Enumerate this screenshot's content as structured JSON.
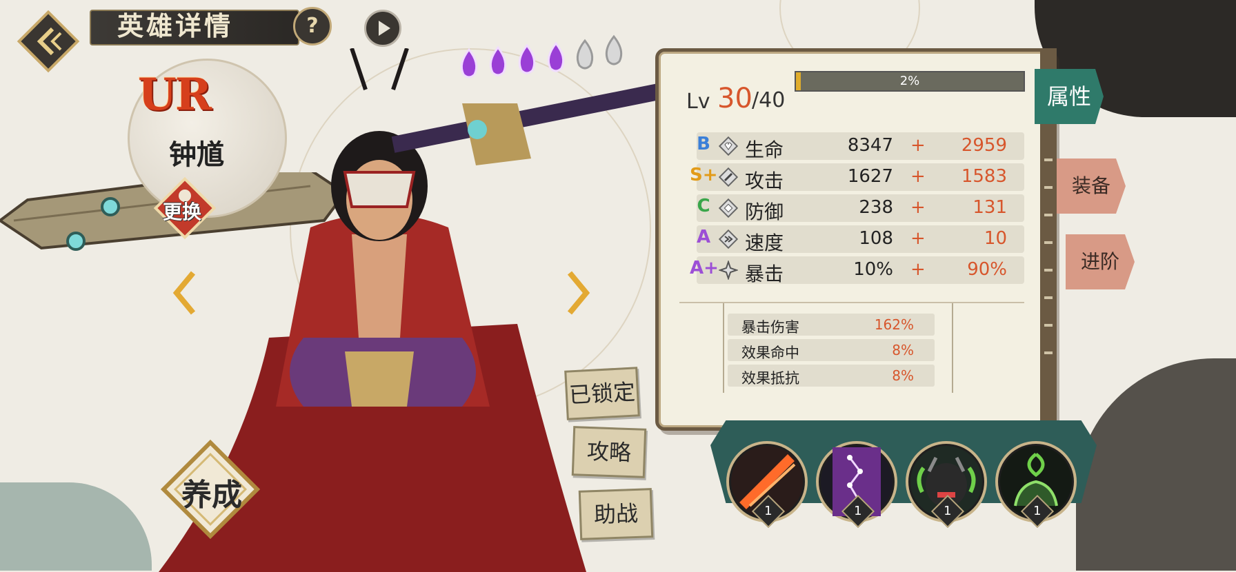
{
  "header": {
    "title": "英雄详情",
    "help_label": "?"
  },
  "hero": {
    "rarity": "UR",
    "name": "钟馗",
    "swap_label": "更换",
    "stars_filled": 4,
    "stars_total": 6
  },
  "side_buttons": {
    "locked": "已锁定",
    "guide": "攻略",
    "support": "助战",
    "cultivate": "养成"
  },
  "level": {
    "label": "Lv",
    "current": "30",
    "max": "/40",
    "exp_text": "2%",
    "exp_fraction": 0.02
  },
  "stats": [
    {
      "grade": "B",
      "grade_color": "#3a7fd8",
      "name": "生命",
      "base": "8347",
      "plus": "+",
      "bonus": "2959"
    },
    {
      "grade": "S+",
      "grade_color": "#e29b18",
      "name": "攻击",
      "base": "1627",
      "plus": "+",
      "bonus": "1583"
    },
    {
      "grade": "C",
      "grade_color": "#3aa64a",
      "name": "防御",
      "base": "238",
      "plus": "+",
      "bonus": "131"
    },
    {
      "grade": "A",
      "grade_color": "#9c4fd6",
      "name": "速度",
      "base": "108",
      "plus": "+",
      "bonus": "10"
    },
    {
      "grade": "A+",
      "grade_color": "#9c4fd6",
      "name": "暴击",
      "base": "10%",
      "plus": "+",
      "bonus": "90%"
    }
  ],
  "sub_stats": [
    {
      "name": "暴击伤害",
      "value": "162%"
    },
    {
      "name": "效果命中",
      "value": "8%"
    },
    {
      "name": "效果抵抗",
      "value": "8%"
    }
  ],
  "tabs": {
    "attributes": "属性",
    "equipment": "装备",
    "advance": "进阶"
  },
  "skills": [
    {
      "icon": "flame-slash-icon",
      "level": "1"
    },
    {
      "icon": "purple-constellation-icon",
      "level": "1"
    },
    {
      "icon": "demon-face-icon",
      "level": "1"
    },
    {
      "icon": "green-spirit-icon",
      "level": "1"
    }
  ],
  "colors": {
    "accent_orange": "#d7562c",
    "tab_active": "#2f7a6a",
    "tab_inactive": "#d89a86"
  }
}
